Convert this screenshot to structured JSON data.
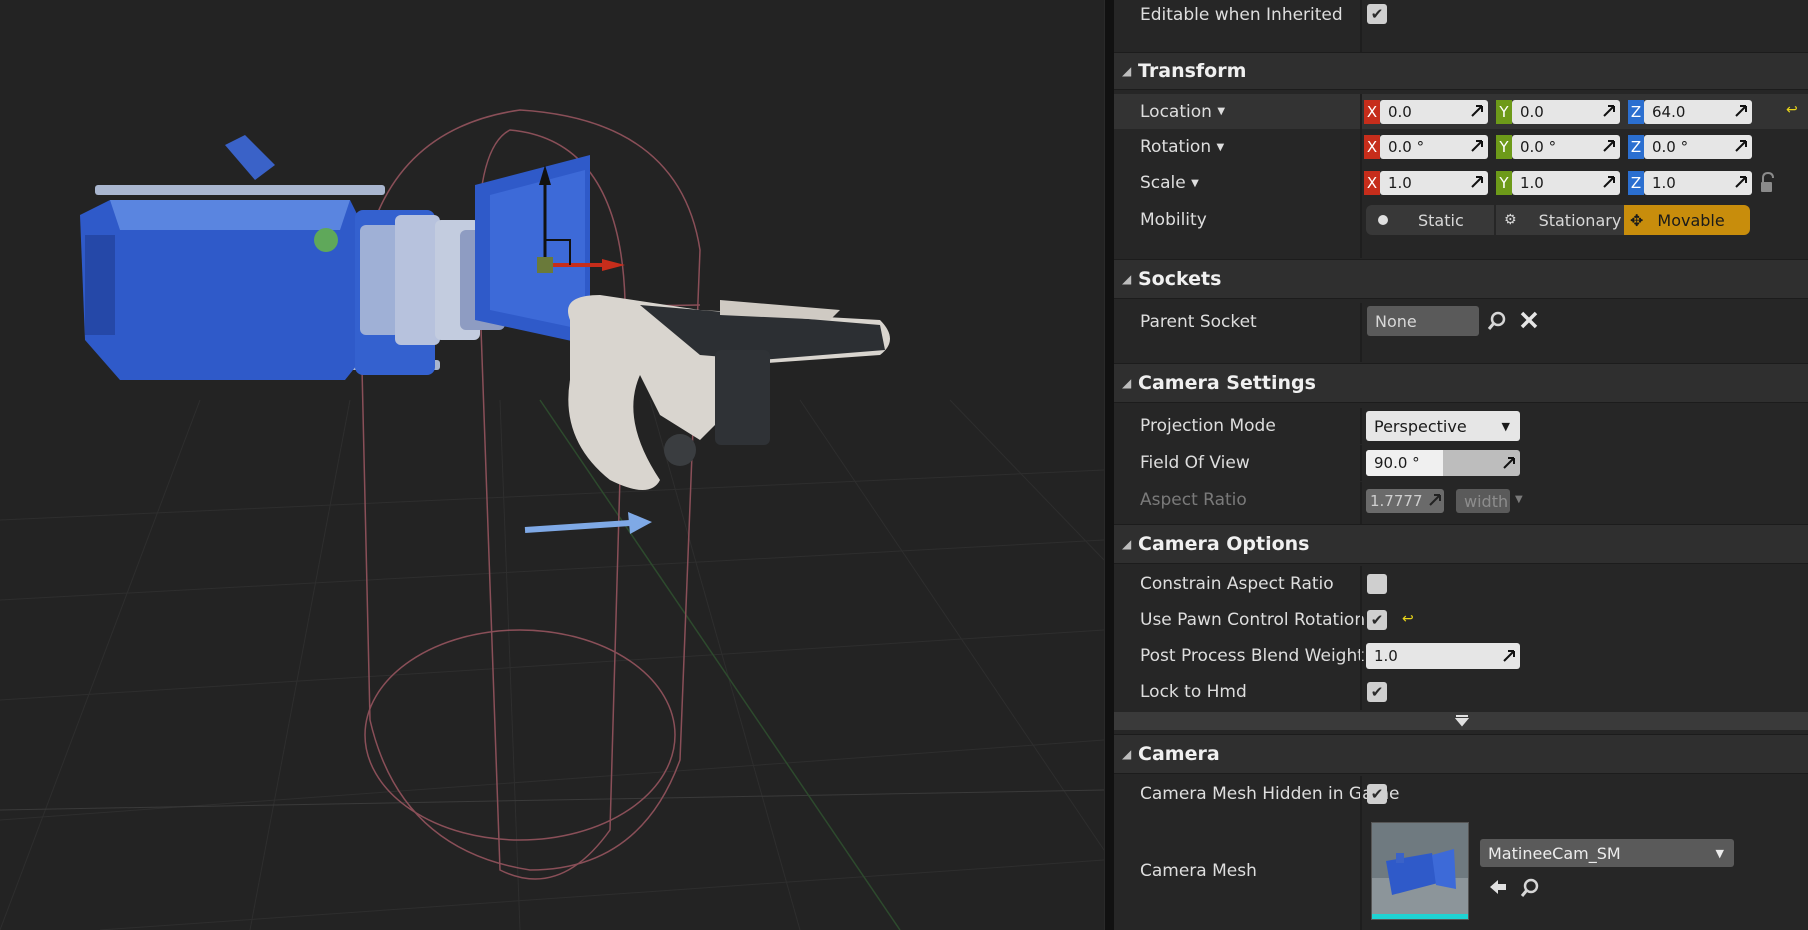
{
  "editable_when_inherited": {
    "label": "Editable when Inherited",
    "checked": true
  },
  "transform": {
    "title": "Transform",
    "location": {
      "label": "Location",
      "x": "0.0",
      "y": "0.0",
      "z": "64.0"
    },
    "rotation": {
      "label": "Rotation",
      "x": "0.0 °",
      "y": "0.0 °",
      "z": "0.0 °"
    },
    "scale": {
      "label": "Scale",
      "x": "1.0",
      "y": "1.0",
      "z": "1.0"
    },
    "mobility": {
      "label": "Mobility",
      "options": [
        "Static",
        "Stationary",
        "Movable"
      ],
      "selected": "Movable"
    },
    "axis_labels": {
      "x": "X",
      "y": "Y",
      "z": "Z"
    }
  },
  "sockets": {
    "title": "Sockets",
    "parent_socket": {
      "label": "Parent Socket",
      "value": "None"
    }
  },
  "camera_settings": {
    "title": "Camera Settings",
    "projection_mode": {
      "label": "Projection Mode",
      "value": "Perspective"
    },
    "field_of_view": {
      "label": "Field Of View",
      "value": "90.0 °",
      "fraction": 0.5
    },
    "aspect_ratio": {
      "label": "Aspect Ratio",
      "value": "1.7777",
      "axis": "width"
    }
  },
  "camera_options": {
    "title": "Camera Options",
    "constrain_aspect_ratio": {
      "label": "Constrain Aspect Ratio",
      "checked": false
    },
    "use_pawn_control_rotation": {
      "label": "Use Pawn Control Rotation",
      "checked": true
    },
    "post_process_blend_weight": {
      "label": "Post Process Blend Weight",
      "value": "1.0"
    },
    "lock_to_hmd": {
      "label": "Lock to Hmd",
      "checked": true
    }
  },
  "camera": {
    "title": "Camera",
    "mesh_hidden_in_game": {
      "label": "Camera Mesh Hidden in Game",
      "checked": true
    },
    "camera_mesh": {
      "label": "Camera Mesh",
      "asset": "MatineeCam_SM"
    }
  },
  "icons": {
    "checkmark": "✔",
    "reset_arrow": "↩",
    "collapse": "◢",
    "lock": "lock-icon",
    "search": "search-icon",
    "clear": "clear-icon",
    "use_selected": "arrow-left-icon",
    "browse": "search-icon",
    "expand_more": "chevron-down-icon"
  },
  "colors": {
    "accent_selected": "#c88d0c",
    "axis_x": "#c62d1b",
    "axis_y": "#6d9a19",
    "axis_z": "#2b6fd0",
    "reset": "#e8d41a"
  }
}
